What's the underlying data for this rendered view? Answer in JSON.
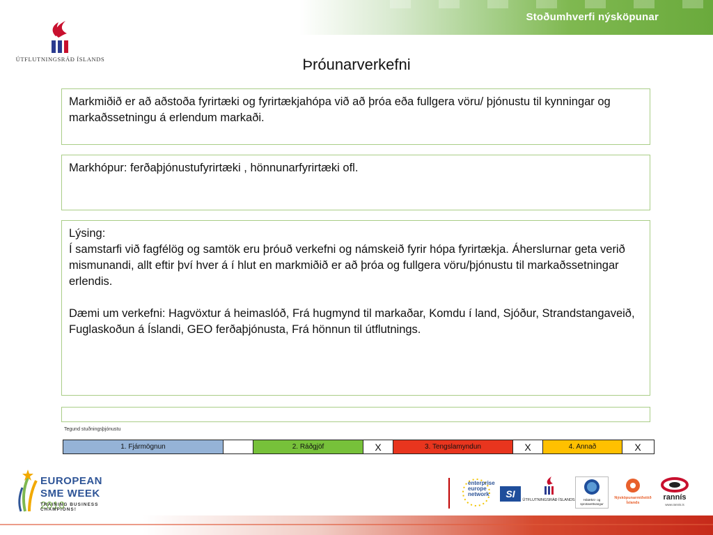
{
  "banner": {
    "title": "Stoðumhverfi nýsköpunar"
  },
  "logo": {
    "name": "ÚTFLUTNINGSRÁÐ ÍSLANDS"
  },
  "slide": {
    "title": "Þróunarverkefni"
  },
  "boxes": {
    "goal": "Markmiðið er að aðstoða fyrirtæki og fyrirtækjahópa við að þróa eða fullgera vöru/ þjónustu til kynningar og markaðssetningu á erlendum markaði.",
    "target": "Markhópur: ferðaþjónustufyrirtæki , hönnunarfyrirtæki ofl.",
    "description": {
      "heading": "Lýsing:",
      "p1": "Í samstarfi við fagfélög og samtök eru þróuð verkefni og námskeið fyrir hópa fyrirtækja. Áherslurnar geta verið mismunandi, allt eftir því hver á í hlut en markmiðið er að þróa og fullgera vöru/þjónustu til markaðssetningar erlendis.",
      "p2": "Dæmi um verkefni: Hagvöxtur á heimaslóð, Frá hugmynd til markaðar, Komdu í land, Sjóður, Strandstangaveið, Fuglaskoðun á Íslandi, GEO ferðaþjónusta, Frá hönnun til útflutnings."
    }
  },
  "support": {
    "label": "Tegund stuðningsþjónustu",
    "cells": [
      {
        "label": "1. Fjármögnun",
        "mark": "",
        "color": "#95b3d7"
      },
      {
        "label": "2. Ráðgjöf",
        "mark": "X",
        "color": "#77c13a"
      },
      {
        "label": "3. Tengslamyndun",
        "mark": "X",
        "color": "#e8351e"
      },
      {
        "label": "4. Annað",
        "mark": "X",
        "color": "#ffc000"
      }
    ]
  },
  "footer": {
    "sme": {
      "line1": "EUROPEAN",
      "line2": "SME WEEK",
      "year": "2010",
      "tagline": "TRAINING BUSINESS CHAMPIONS!"
    },
    "partners": {
      "een": {
        "l1": "enterprise",
        "l2": "europe",
        "l3": "network"
      },
      "si": "SI",
      "ui": "ÚTFLUTNINGSRÁÐ ÍSLANDS",
      "hv": {
        "l1": "Hátækni- og",
        "l2": "sprotavettvangur"
      },
      "nmi": {
        "l1": "Nýsköpunarmiðstöð",
        "l2": "Íslands"
      },
      "rannis": {
        "name": "rannís",
        "url": "www.rannis.is"
      }
    }
  }
}
